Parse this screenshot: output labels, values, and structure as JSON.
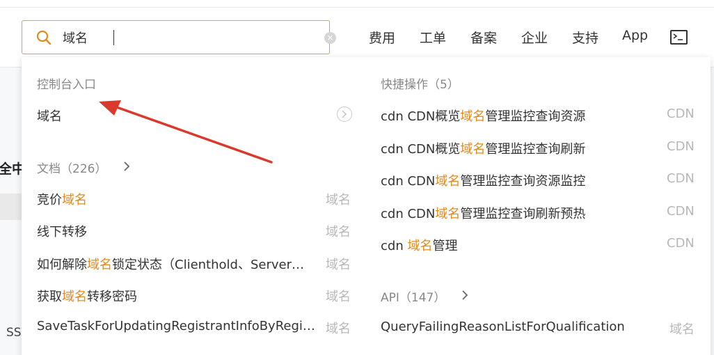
{
  "search": {
    "value": "域名",
    "clear_glyph": "×"
  },
  "nav": {
    "items": [
      "费用",
      "工单",
      "备案",
      "企业",
      "支持",
      "App"
    ],
    "terminal_icon": "terminal-icon"
  },
  "background": {
    "left_fragment": "全中",
    "bottom_fragment": "SS"
  },
  "console_entry": {
    "title": "控制台入口",
    "item_label": "域名"
  },
  "docs": {
    "title": "文档（226）",
    "items": [
      {
        "pre": "竞价",
        "hl": "域名",
        "post": "",
        "tag": "域名"
      },
      {
        "pre": "线下转移",
        "hl": "",
        "post": "",
        "tag": "域名"
      },
      {
        "pre": "如何解除",
        "hl": "域名",
        "post": "锁定状态（Clienthold、Server…",
        "tag": "域名"
      },
      {
        "pre": "获取",
        "hl": "域名",
        "post": "转移密码",
        "tag": "域名"
      },
      {
        "pre": "SaveTaskForUpdatingRegistrantInfoByRegi…",
        "hl": "",
        "post": "",
        "tag": "域名"
      }
    ]
  },
  "quick_actions": {
    "title": "快捷操作（5）",
    "items": [
      {
        "pre": "cdn CDN概览",
        "hl": "域名",
        "post": "管理监控查询资源",
        "tag": "CDN"
      },
      {
        "pre": "cdn CDN概览",
        "hl": "域名",
        "post": "管理监控查询刷新",
        "tag": "CDN"
      },
      {
        "pre": "cdn CDN",
        "hl": "域名",
        "post": "管理监控查询资源监控",
        "tag": "CDN"
      },
      {
        "pre": "cdn CDN",
        "hl": "域名",
        "post": "管理监控查询刷新预热",
        "tag": "CDN"
      },
      {
        "pre": "cdn ",
        "hl": "域名",
        "post": "管理",
        "tag": "CDN"
      }
    ]
  },
  "api": {
    "title": "API（147）",
    "items": [
      {
        "pre": "QueryFailingReasonListForQualification",
        "hl": "",
        "post": "",
        "tag": "域名"
      }
    ]
  },
  "colors": {
    "accent": "#e08a1e",
    "search_border": "#e5a04a",
    "annotation_arrow": "#d93a2b"
  }
}
